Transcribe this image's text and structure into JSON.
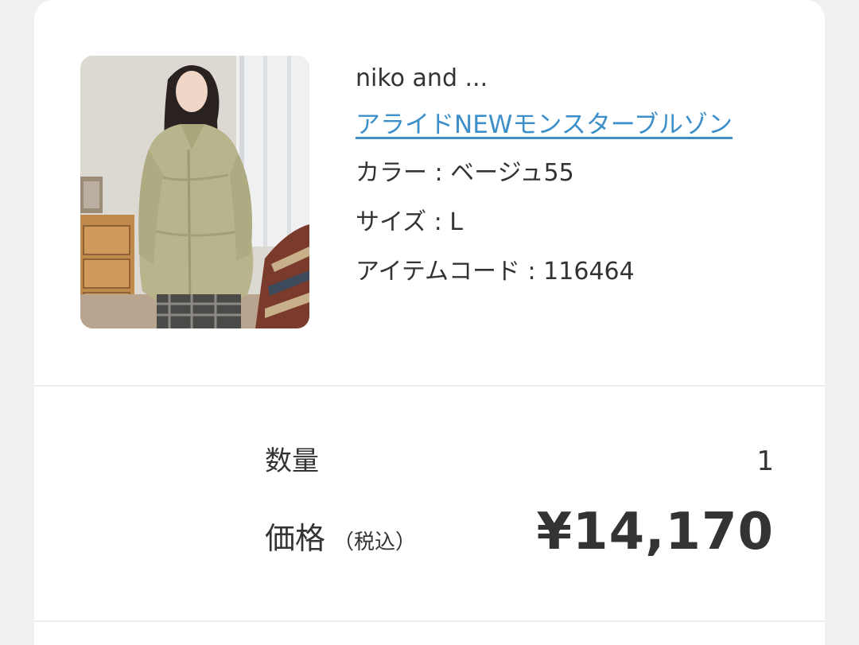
{
  "product": {
    "brand": "niko and ...",
    "name": "アライドNEWモンスターブルゾン",
    "color_label": "カラー : ベージュ55",
    "size_label": "サイズ : L",
    "item_code_label": "アイテムコード : 116464",
    "image_icon": "product-photo-coat"
  },
  "summary": {
    "quantity_label": "数量",
    "quantity_value": "1",
    "price_label": "価格",
    "tax_note": "（税込）",
    "price_value": "¥14,170"
  },
  "colors": {
    "link": "#3d8fc9",
    "text": "#333333",
    "divider": "#ececec",
    "background": "#f0f0f0",
    "card": "#ffffff"
  }
}
